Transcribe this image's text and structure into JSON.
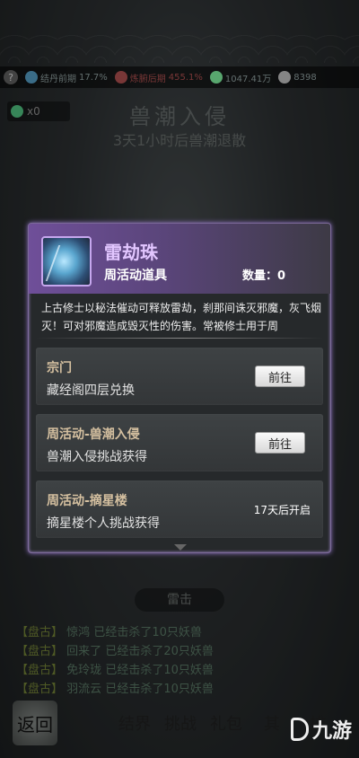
{
  "resources": [
    {
      "icon": "crystal-icon",
      "label": "结丹前期",
      "value": "17.7%",
      "color": "#5aa6cf"
    },
    {
      "icon": "body-icon",
      "label": "炼腑后期",
      "value": "455.1%",
      "color": "#b55"
    },
    {
      "icon": "spirit-stone-icon",
      "value": "1047.41万",
      "color": "#8fa"
    },
    {
      "icon": "coin-icon",
      "value": "8398",
      "color": "#ccc"
    }
  ],
  "item_count": "x0",
  "page_title": "兽潮入侵",
  "page_countdown": "3天1小时后兽潮退散",
  "popup": {
    "item_name": "雷劫珠",
    "item_type": "周活动道具",
    "quantity": "数量：0",
    "description": "上古修士以秘法催动可释放雷劫，刹那间诛灭邪魔，灰飞烟灭！可对邪魔造成毁灭性的伤害。常被修士用于周",
    "sources": [
      {
        "title": "宗门",
        "desc": "藏经阁四层兑换",
        "action": "前往"
      },
      {
        "title": "周活动-兽潮入侵",
        "desc": "兽潮入侵挑战获得",
        "action": "前往"
      },
      {
        "title": "周活动-摘星楼",
        "desc": "摘星楼个人挑战获得",
        "status": "17天后开启"
      }
    ]
  },
  "strike_label": "雷击",
  "log": [
    {
      "tag": "【盘古】",
      "name": "惊鸿",
      "text": "已经击杀了10只妖兽"
    },
    {
      "tag": "【盘古】",
      "name": "回来了",
      "text": "已经击杀了20只妖兽"
    },
    {
      "tag": "【盘古】",
      "name": "免玲珑",
      "text": "已经击杀了10只妖兽"
    },
    {
      "tag": "【盘古】",
      "name": "羽流云",
      "text": "已经击杀了10只妖兽"
    }
  ],
  "nav": {
    "back": "返回",
    "items": [
      "结界",
      "挑战",
      "礼包",
      "其",
      "排"
    ]
  },
  "brand": "九游"
}
